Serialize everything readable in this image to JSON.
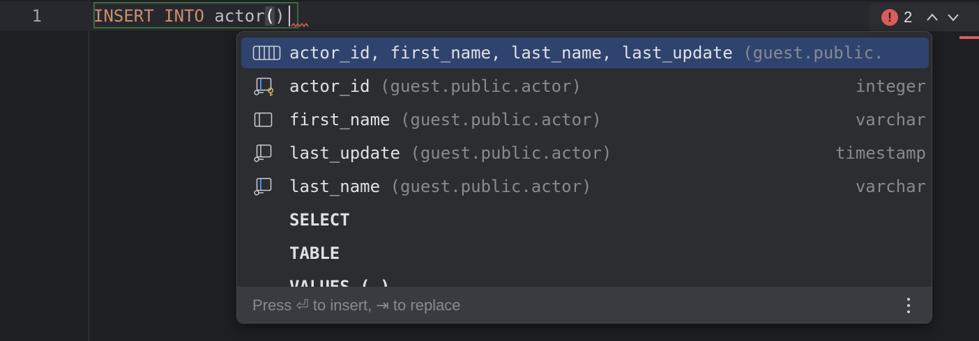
{
  "editor": {
    "line_number": "1",
    "code_keyword": "INSERT INTO",
    "code_table": " actor",
    "code_paren": "(",
    "code_close": ")"
  },
  "problems": {
    "count": "2",
    "icon": "error-icon",
    "color": "#db5c5c"
  },
  "completion": {
    "items": [
      {
        "icon": "columns-icon",
        "label": "actor_id, first_name, last_name, last_update",
        "context": "(guest.public.",
        "type": "",
        "selected": true
      },
      {
        "icon": "primary-key-column-icon",
        "label": "actor_id",
        "context": "(guest.public.actor)",
        "type": "integer"
      },
      {
        "icon": "column-icon",
        "label": "first_name",
        "context": "(guest.public.actor)",
        "type": "varchar"
      },
      {
        "icon": "not-null-column-icon",
        "label": "last_update",
        "context": "(guest.public.actor)",
        "type": "timestamp"
      },
      {
        "icon": "indexed-column-icon",
        "label": "last_name",
        "context": "(guest.public.actor)",
        "type": "varchar"
      },
      {
        "icon": "",
        "label": "SELECT",
        "context": "",
        "type": ""
      },
      {
        "icon": "",
        "label": "TABLE",
        "context": "",
        "type": ""
      },
      {
        "icon": "",
        "label": "VALUES (…)",
        "context": "",
        "type": ""
      }
    ],
    "hint": "Press ⏎ to insert, ⇥ to replace",
    "menu_icon": "more-vertical-icon"
  },
  "colors": {
    "background": "#1e1f22",
    "popup": "#2b2d30",
    "selection": "#2e436e",
    "keyword": "#cf8e6d",
    "accent_blue": "#548af7",
    "key_yellow": "#d6ae58"
  }
}
